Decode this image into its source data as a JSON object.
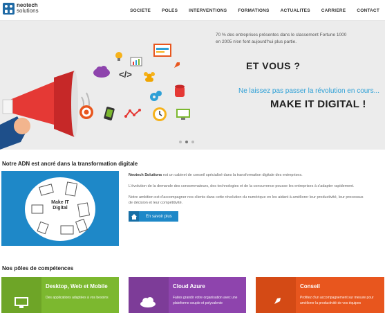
{
  "logo": {
    "line1": "neotech",
    "line2": "solutions"
  },
  "nav": {
    "items": [
      "SOCIETE",
      "POLES",
      "INTERVENTIONS",
      "FORMATIONS",
      "ACTUALITES",
      "CARRIERE",
      "CONTACT"
    ]
  },
  "hero": {
    "intro": "70 % des entreprises présentes dans le classement Fortune 1000 en 2005 n'en font aujourd'hui plus partie.",
    "question": "ET VOUS ?",
    "tagline": "Ne laissez pas passer la révolution en cours...",
    "headline": "MAKE IT DIGITAL !",
    "slides": 3,
    "active_slide": 1
  },
  "adn": {
    "title": "Notre ADN est ancré dans la transformation digitale",
    "image_label_1": "Make IT",
    "image_label_2": "Digital",
    "company": "Neotech Solutions",
    "p1_rest": " est un cabinet de conseil spécialisé dans la transformation digitale des entreprises.",
    "p2": "L'évolution de la demande des consommateurs, des technologies et de la concurrence pousse les entreprises à s'adapter rapidement.",
    "p3": "Notre ambition est d'accompagner nos clients dans cette révolution du numérique en les aidant à améliorer leur productivité, leur processus de décision et leur compétitivité.",
    "button_label": "En savoir plus"
  },
  "poles": {
    "title": "Nos pôles de compétences",
    "items": [
      {
        "title": "Desktop, Web et Mobile",
        "desc": "Des applications adaptées à vos besoins",
        "color": "#7cb82f",
        "icon": "monitor-icon"
      },
      {
        "title": "Cloud Azure",
        "desc": "Faites grandir votre organisation avec une plateforme souple et polyvalente",
        "color": "#8e44ad",
        "icon": "cloud-icon"
      },
      {
        "title": "Conseil",
        "desc": "Profitez d'un accompagnement sur mesure pour améliorer la productivité de vos équipes",
        "color": "#e8561e",
        "icon": "rocket-icon"
      }
    ]
  },
  "colors": {
    "accent": "#1e88c8",
    "hero_bg": "#ececec",
    "megaphone": "#e53935"
  }
}
